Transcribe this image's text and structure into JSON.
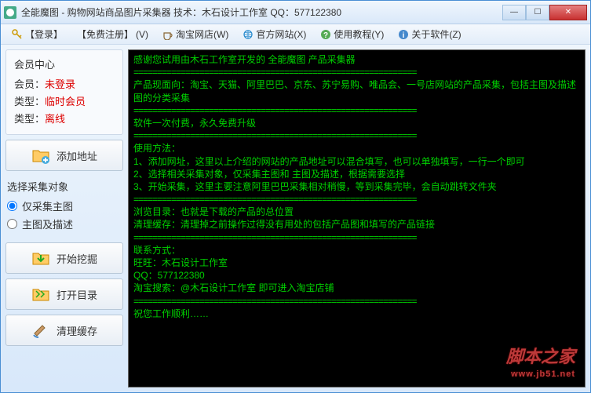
{
  "window": {
    "title": "全能魔图 - 购物网站商品图片采集器   技术：木石设计工作室   QQ：577122380"
  },
  "menu": {
    "login": "【登录】",
    "register": "【免费注册】",
    "v": "(V)",
    "taobao": "淘宝网店(W)",
    "official": "官方网站(X)",
    "tutorial": "使用教程(Y)",
    "about": "关于软件(Z)"
  },
  "sidebar": {
    "center_title": "会员中心",
    "member_label": "会员：",
    "member_value": "未登录",
    "type1_label": "类型：",
    "type1_value": "临时会员",
    "type2_label": "类型：",
    "type2_value": "离线",
    "add_url": "添加地址",
    "select_title": "选择采集对象",
    "radio1": "仅采集主图",
    "radio2": "主图及描述",
    "start": "开始挖掘",
    "open_dir": "打开目录",
    "clear_cache": "清理缓存"
  },
  "console": {
    "sep": "============================================================",
    "l1": "感谢您试用由木石工作室开发的 全能魔图 产品采集器",
    "l2": "产品现面向：淘宝、天猫、阿里巴巴、京东、苏宁易购、唯品会、一号店网站的产品采集，包括主图及描述",
    "l3": "图的分类采集",
    "l4": "软件一次付费，永久免费升级",
    "l5": "使用方法：",
    "l6": "1、添加网址，这里以上介绍的网站的产品地址可以混合填写，也可以单独填写，一行一个即可",
    "l7": "2、选择相关采集对象，仅采集主图和 主图及描述，根据需要选择",
    "l8": "3、开始采集，这里主要注意阿里巴巴采集相对稍慢，等到采集完毕，会自动跳转文件夹",
    "l9": "浏览目录：也就是下载的产品的总位置",
    "l10": "清理缓存：清理掉之前操作过得没有用处的包括产品图和填写的产品链接",
    "l11": "联系方式：",
    "l12": "旺旺：木石设计工作室",
    "l13": "QQ：577122380",
    "l14": "淘宝搜索：@木石设计工作室 即可进入淘宝店铺",
    "l15": "祝您工作顺利……"
  },
  "watermark": {
    "text": "脚本之家",
    "url": "www.jb51.net"
  }
}
